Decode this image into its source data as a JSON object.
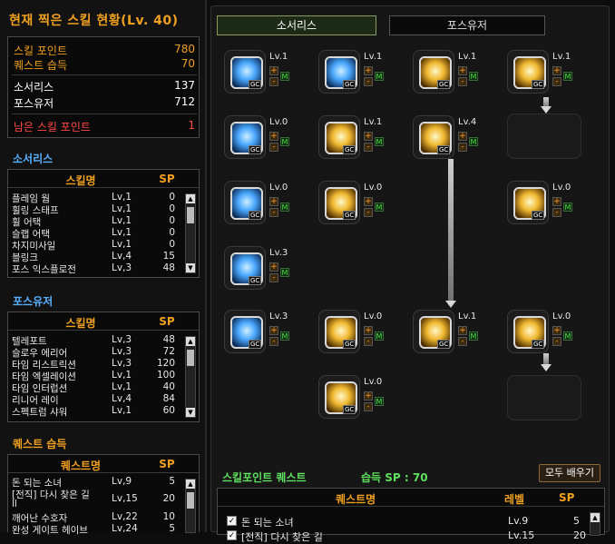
{
  "header": {
    "title": "현재 찍은 스킬 현황(Lv. 40)"
  },
  "stats": {
    "skill_point_label": "스킬 포인트",
    "skill_point_value": "780",
    "quest_gain_label": "퀘스트 습득",
    "quest_gain_value": "70",
    "sorcerer_label": "소서리스",
    "sorcerer_value": "137",
    "force_user_label": "포스유저",
    "force_user_value": "712",
    "remaining_label": "남은 스킬 포인트",
    "remaining_value": "1"
  },
  "sorceress_section": {
    "title": "소서리스",
    "col_name": "스킬명",
    "col_sp": "SP",
    "rows": [
      {
        "name": "플레임 웜",
        "lv": "Lv,1",
        "sp": "0"
      },
      {
        "name": "휠링 스태프",
        "lv": "Lv,1",
        "sp": "0"
      },
      {
        "name": "휠 어택",
        "lv": "Lv,1",
        "sp": "0"
      },
      {
        "name": "슬랩 어택",
        "lv": "Lv,1",
        "sp": "0"
      },
      {
        "name": "차지미사일",
        "lv": "Lv,1",
        "sp": "0"
      },
      {
        "name": "블링크",
        "lv": "Lv,4",
        "sp": "15"
      },
      {
        "name": "포스 익스플로전",
        "lv": "Lv,3",
        "sp": "48"
      }
    ]
  },
  "forceuser_section": {
    "title": "포스유저",
    "col_name": "스킬명",
    "col_sp": "SP",
    "rows": [
      {
        "name": "텔레포트",
        "lv": "Lv,3",
        "sp": "48"
      },
      {
        "name": "슬로우 에리어",
        "lv": "Lv,3",
        "sp": "72"
      },
      {
        "name": "타임 리스트릭션",
        "lv": "Lv,3",
        "sp": "120"
      },
      {
        "name": "타임 엑셀레이션",
        "lv": "Lv,1",
        "sp": "100"
      },
      {
        "name": "타임 인터럽션",
        "lv": "Lv,1",
        "sp": "40"
      },
      {
        "name": "리니어 레이",
        "lv": "Lv,4",
        "sp": "84"
      },
      {
        "name": "스펙트럼 샤워",
        "lv": "Lv,1",
        "sp": "60"
      }
    ]
  },
  "quest_section": {
    "title": "퀘스트 습득",
    "col_name": "퀘스트명",
    "col_sp": "SP",
    "rows": [
      {
        "name": "돈 되는 소녀",
        "lv": "Lv,9",
        "sp": "5"
      },
      {
        "name": "[전직] 다시 찾은 길",
        "name2": "ll",
        "lv": "Lv,15",
        "sp": "20"
      },
      {
        "name": "깨어난 수호자",
        "lv": "Lv,22",
        "sp": "10"
      },
      {
        "name": "완성 게이트 헤이브",
        "lv": "Lv,24",
        "sp": "5"
      }
    ]
  },
  "tabs": {
    "active": "소서리스",
    "inactive": "포스유저"
  },
  "skills": [
    {
      "lv": "Lv.1",
      "color": "blue"
    },
    {
      "lv": "Lv.1",
      "color": "blue"
    },
    {
      "lv": "Lv.1",
      "color": "gold"
    },
    {
      "lv": "Lv.1",
      "color": "gold"
    },
    {
      "lv": "Lv.0",
      "color": "blue"
    },
    {
      "lv": "Lv.1",
      "color": "gold"
    },
    {
      "lv": "Lv.4",
      "color": "gold"
    },
    {
      "lv": "Lv.0",
      "color": "blue"
    },
    {
      "lv": "Lv.0",
      "color": "gold"
    },
    {
      "lv": "Lv.0",
      "color": "gold"
    },
    {
      "lv": "Lv.3",
      "color": "blue"
    },
    {
      "lv": "Lv.3",
      "color": "blue"
    },
    {
      "lv": "Lv.0",
      "color": "gold"
    },
    {
      "lv": "Lv.1",
      "color": "gold"
    },
    {
      "lv": "Lv.0",
      "color": "gold"
    },
    {
      "lv": "Lv.0",
      "color": "gold"
    }
  ],
  "gc_label": "GC",
  "plus_label": "+",
  "minus_label": "-",
  "m_label": "M",
  "quest_panel": {
    "title": "스킬포인트 퀘스트",
    "sp_label": "습득 SP : 70",
    "fill_all_button": "모두 배우기",
    "col_name": "퀘스트명",
    "col_level": "레벨",
    "col_sp": "SP",
    "rows": [
      {
        "checked": true,
        "name": "돈 되는 소녀",
        "level": "Lv.9",
        "sp": "5"
      },
      {
        "checked": true,
        "name": "[전직] 다시 찾은 길",
        "level": "Lv.15",
        "sp": "20"
      }
    ]
  },
  "colors": {
    "accent": "#f0a020",
    "title_blue": "#5ab0ff",
    "quest_green": "#5ee05e",
    "remaining_red": "#ff4a4a"
  }
}
